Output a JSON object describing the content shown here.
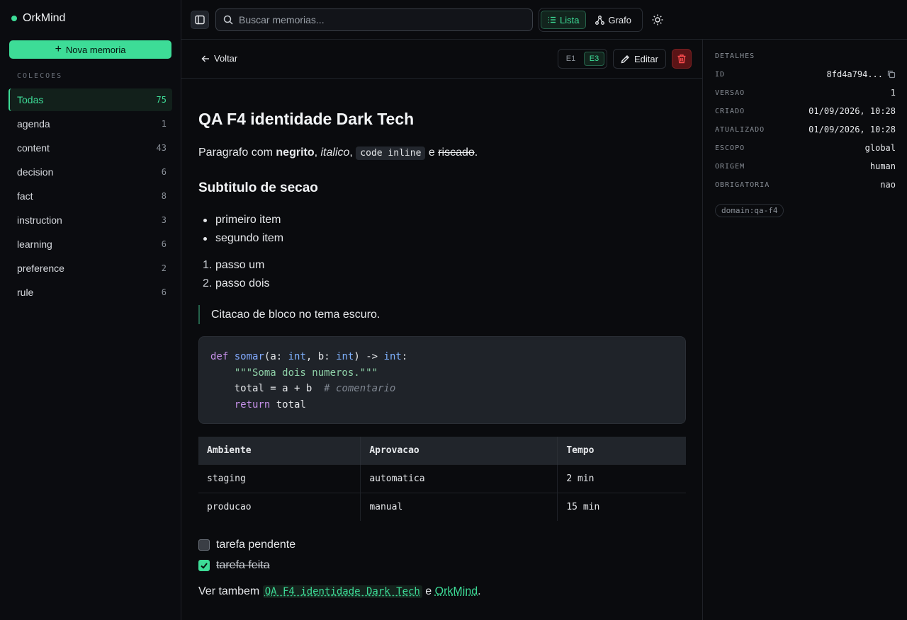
{
  "app": {
    "name": "OrkMind",
    "accent": "#3ddc97"
  },
  "sidebar": {
    "new_button": "Nova memoria",
    "section_label": "COLECOES",
    "collections": [
      {
        "label": "Todas",
        "count": "75",
        "active": true
      },
      {
        "label": "agenda",
        "count": "1"
      },
      {
        "label": "content",
        "count": "43"
      },
      {
        "label": "decision",
        "count": "6"
      },
      {
        "label": "fact",
        "count": "8"
      },
      {
        "label": "instruction",
        "count": "3"
      },
      {
        "label": "learning",
        "count": "6"
      },
      {
        "label": "preference",
        "count": "2"
      },
      {
        "label": "rule",
        "count": "6"
      }
    ]
  },
  "topbar": {
    "search_placeholder": "Buscar memorias...",
    "view_list": "Lista",
    "view_graph": "Grafo",
    "active_view": "Lista"
  },
  "main": {
    "back_label": "Voltar",
    "versions": [
      "E1",
      "E3"
    ],
    "active_version": "E3",
    "edit_label": "Editar",
    "title": "QA F4 identidade Dark Tech",
    "paragraph": {
      "prefix": "Paragrafo com ",
      "bold": "negrito",
      "sep1": ", ",
      "italic": "italico",
      "sep2": ", ",
      "code": "code inline",
      "sep3": " e ",
      "strike": "riscado",
      "end": "."
    },
    "subtitle": "Subtitulo de secao",
    "bullets": [
      "primeiro item",
      "segundo item"
    ],
    "steps": [
      "passo um",
      "passo dois"
    ],
    "quote": "Citacao de bloco no tema escuro.",
    "code": {
      "l1_kw": "def",
      "l1_fn": "somar",
      "l1_a": "(a: ",
      "l1_t1": "int",
      "l1_b": ", b: ",
      "l1_t2": "int",
      "l1_c": ") -> ",
      "l1_t3": "int",
      "l1_d": ":",
      "l2_doc": "\"\"\"Soma dois numeros.\"\"\"",
      "l3_code": "total = a + b",
      "l3_comment": "# comentario",
      "l4_kw": "return",
      "l4_rest": " total"
    },
    "table": {
      "headers": [
        "Ambiente",
        "Aprovacao",
        "Tempo"
      ],
      "rows": [
        [
          "staging",
          "automatica",
          "2 min"
        ],
        [
          "producao",
          "manual",
          "15 min"
        ]
      ]
    },
    "tasks": [
      {
        "label": "tarefa pendente",
        "done": false
      },
      {
        "label": "tarefa feita",
        "done": true
      }
    ],
    "see_also": {
      "prefix": "Ver tambem ",
      "link1": "QA F4 identidade Dark Tech",
      "middle": " e ",
      "link2": "OrkMind",
      "end": "."
    }
  },
  "details": {
    "title": "DETALHES",
    "rows": [
      {
        "label": "ID",
        "value": "8fd4a794..."
      },
      {
        "label": "VERSAO",
        "value": "1"
      },
      {
        "label": "CRIADO",
        "value": "01/09/2026, 10:28"
      },
      {
        "label": "ATUALIZADO",
        "value": "01/09/2026, 10:28"
      },
      {
        "label": "ESCOPO",
        "value": "global"
      },
      {
        "label": "ORIGEM",
        "value": "human"
      },
      {
        "label": "OBRIGATORIA",
        "value": "nao"
      }
    ],
    "tag": "domain:qa-f4"
  }
}
